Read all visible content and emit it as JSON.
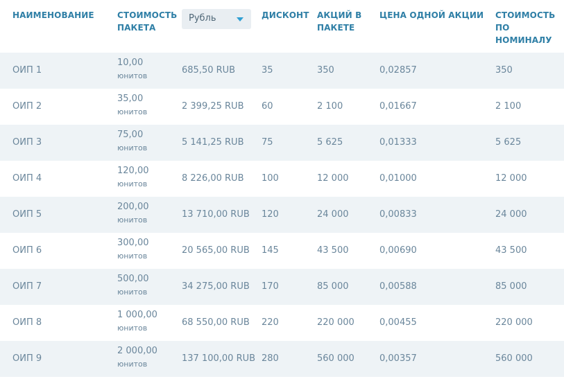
{
  "headers": {
    "name": "НАИМЕНОВАНИЕ",
    "package_cost": "СТОИМОСТЬ ПАКЕТА",
    "currency_selected": "Рубль",
    "discount": "ДИСКОНТ",
    "shares_in_package": "АКЦИЙ В ПАКЕТЕ",
    "price_per_share": "ЦЕНА ОДНОЙ АКЦИИ",
    "nominal_value": "СТОИМОСТЬ ПО НОМИНАЛУ"
  },
  "colors": {
    "header_text": "#2f7fa6",
    "row_alt_bg": "#eef3f6",
    "select_bg": "#e9eef2",
    "caret": "#2f9fd3"
  },
  "rows": [
    {
      "name": "ОИП 1",
      "cost": "10,00",
      "unit": "юнитов",
      "rub": "685,50 RUB",
      "discount": "35",
      "shares": "350",
      "price": "0,02857",
      "nominal": "350"
    },
    {
      "name": "ОИП 2",
      "cost": "35,00",
      "unit": "юнитов",
      "rub": "2 399,25 RUB",
      "discount": "60",
      "shares": "2 100",
      "price": "0,01667",
      "nominal": "2 100"
    },
    {
      "name": "ОИП 3",
      "cost": "75,00",
      "unit": "юнитов",
      "rub": "5 141,25 RUB",
      "discount": "75",
      "shares": "5 625",
      "price": "0,01333",
      "nominal": "5 625"
    },
    {
      "name": "ОИП 4",
      "cost": "120,00",
      "unit": "юнитов",
      "rub": "8 226,00 RUB",
      "discount": "100",
      "shares": "12 000",
      "price": "0,01000",
      "nominal": "12 000"
    },
    {
      "name": "ОИП 5",
      "cost": "200,00",
      "unit": "юнитов",
      "rub": "13 710,00 RUB",
      "discount": "120",
      "shares": "24 000",
      "price": "0,00833",
      "nominal": "24 000"
    },
    {
      "name": "ОИП 6",
      "cost": "300,00",
      "unit": "юнитов",
      "rub": "20 565,00 RUB",
      "discount": "145",
      "shares": "43 500",
      "price": "0,00690",
      "nominal": "43 500"
    },
    {
      "name": "ОИП 7",
      "cost": "500,00",
      "unit": "юнитов",
      "rub": "34 275,00 RUB",
      "discount": "170",
      "shares": "85 000",
      "price": "0,00588",
      "nominal": "85 000"
    },
    {
      "name": "ОИП 8",
      "cost": "1 000,00",
      "unit": "юнитов",
      "rub": "68 550,00 RUB",
      "discount": "220",
      "shares": "220 000",
      "price": "0,00455",
      "nominal": "220 000"
    },
    {
      "name": "ОИП 9",
      "cost": "2 000,00",
      "unit": "юнитов",
      "rub": "137 100,00 RUB",
      "discount": "280",
      "shares": "560 000",
      "price": "0,00357",
      "nominal": "560 000"
    }
  ]
}
